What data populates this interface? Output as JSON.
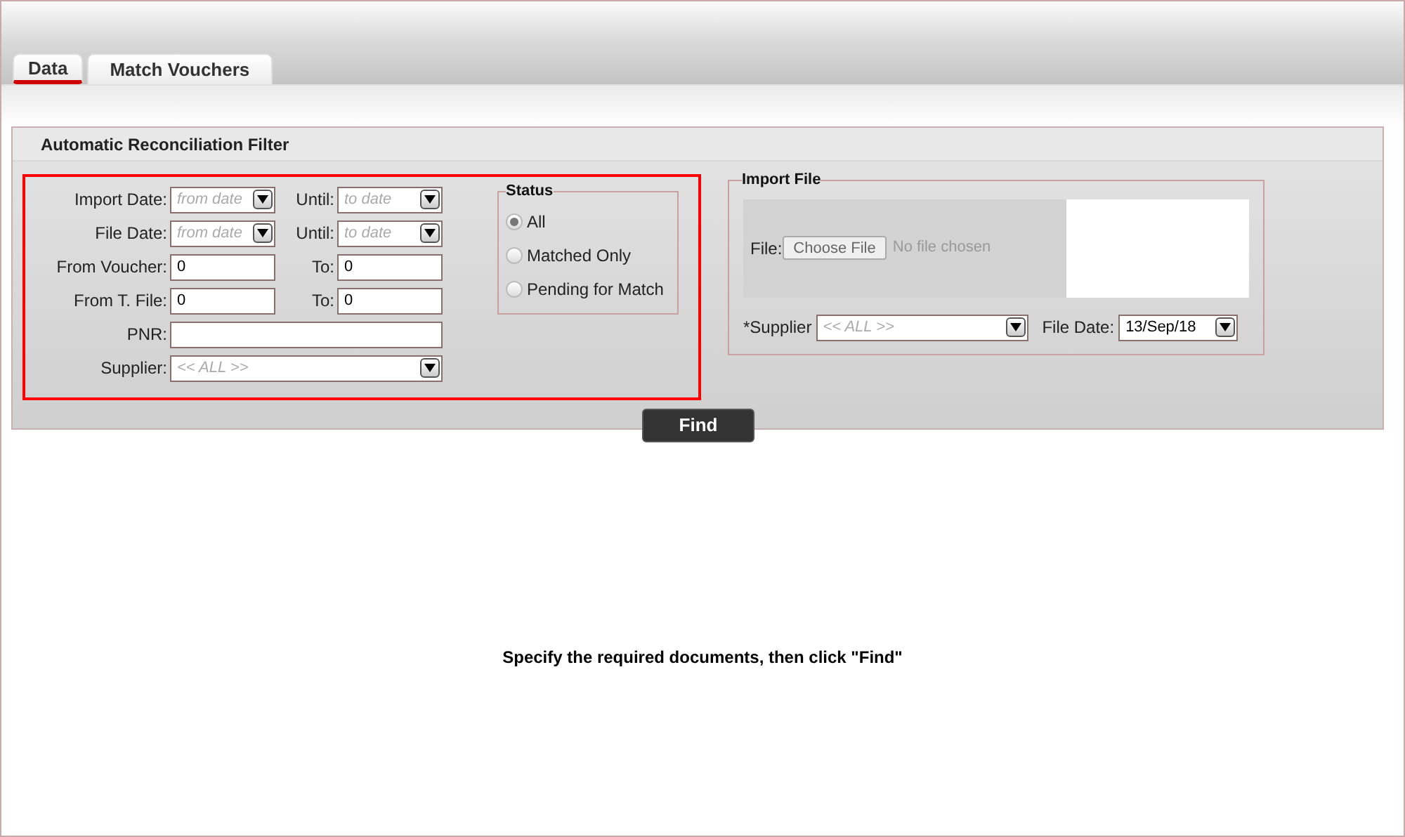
{
  "tabs": [
    {
      "label": "Data",
      "selected": true
    },
    {
      "label": "Match Vouchers",
      "selected": false
    }
  ],
  "panel": {
    "title": "Automatic Reconciliation Filter"
  },
  "filter": {
    "rows": [
      {
        "kind": "date_range",
        "label": "Import Date:",
        "from": {
          "placeholder": "from date"
        },
        "to_label": "Until:",
        "to": {
          "placeholder": "to date"
        }
      },
      {
        "kind": "date_range",
        "label": "File Date:",
        "from": {
          "placeholder": "from date"
        },
        "to_label": "Until:",
        "to": {
          "placeholder": "to date"
        }
      },
      {
        "kind": "number_range",
        "label": "From Voucher:",
        "from": {
          "value": "0"
        },
        "to_label": "To:",
        "to": {
          "value": "0"
        }
      },
      {
        "kind": "number_range",
        "label": "From T. File:",
        "from": {
          "value": "0"
        },
        "to_label": "To:",
        "to": {
          "value": "0"
        }
      },
      {
        "kind": "text",
        "label": "PNR:"
      },
      {
        "kind": "select",
        "label": "Supplier:",
        "placeholder": "<< ALL >>"
      }
    ]
  },
  "status": {
    "title": "Status",
    "options": [
      {
        "label": "All",
        "selected": true
      },
      {
        "label": "Matched Only",
        "selected": false
      },
      {
        "label": "Pending for Match",
        "selected": false
      }
    ]
  },
  "import_file": {
    "title": "Import File",
    "file_label": "File:",
    "choose_button": "Choose File",
    "file_status": "No file chosen",
    "supplier_label": "*Supplier",
    "supplier_placeholder": "<< ALL >>",
    "file_date_label": "File Date:",
    "file_date_value": "13/Sep/18"
  },
  "find_button": "Find",
  "message": "Specify the required documents, then click \"Find\""
}
